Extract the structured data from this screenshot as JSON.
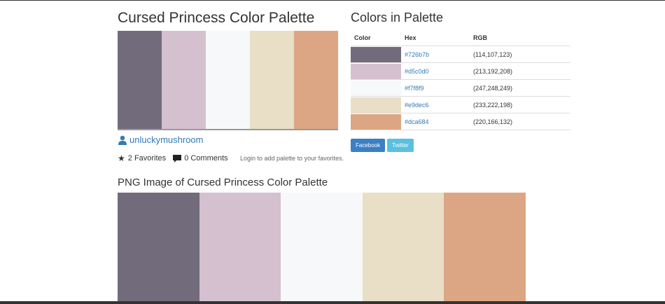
{
  "title": "Cursed Princess Color Palette",
  "colors": [
    {
      "hex": "#726b7b",
      "rgb": "(114,107,123)"
    },
    {
      "hex": "#d5c0d0",
      "rgb": "(213,192,208)"
    },
    {
      "hex": "#f7f8f9",
      "rgb": "(247,248,249)"
    },
    {
      "hex": "#e9dec6",
      "rgb": "(233,222,198)"
    },
    {
      "hex": "#dca684",
      "rgb": "(220,166,132)"
    }
  ],
  "user": {
    "name": "unluckymushroom",
    "icon": "user-icon"
  },
  "meta": {
    "favorites": "2 Favorites",
    "comments": "0 Comments",
    "login_note": "Login to add palette to your favorites."
  },
  "colors_in_palette": {
    "title": "Colors in Palette",
    "headers": [
      "Color",
      "Hex",
      "RGB"
    ]
  },
  "social": {
    "facebook": "Facebook",
    "twitter": "Twitter"
  },
  "png_title": "PNG Image of Cursed Princess Color Palette"
}
